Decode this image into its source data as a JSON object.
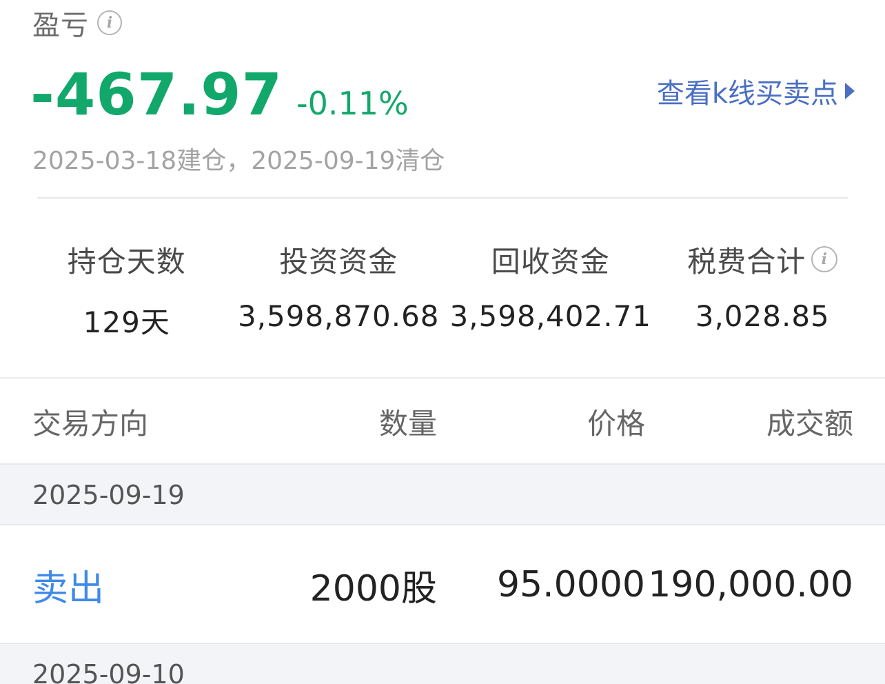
{
  "summary": {
    "title": "盈亏",
    "amount": "-467.97",
    "percent": "-0.11%",
    "kline_link": "查看k线买卖点",
    "date_range": "2025-03-18建仓，2025-09-19清仓",
    "info_glyph": "i"
  },
  "stats": [
    {
      "label": "持仓天数",
      "value": "129天"
    },
    {
      "label": "投资资金",
      "value": "3,598,870.68"
    },
    {
      "label": "回收资金",
      "value": "3,598,402.71"
    },
    {
      "label": "税费合计",
      "value": "3,028.85"
    }
  ],
  "table": {
    "headers": {
      "direction": "交易方向",
      "quantity": "数量",
      "price": "价格",
      "amount": "成交额"
    },
    "groups": [
      {
        "date": "2025-09-19",
        "trades": [
          {
            "direction": "卖出",
            "quantity": "2000股",
            "price": "95.0000",
            "amount": "190,000.00"
          }
        ]
      },
      {
        "date": "2025-09-10",
        "trades": []
      }
    ]
  },
  "colors": {
    "loss_green": "#12a86b",
    "link_blue": "#4a6fc4",
    "sell_blue": "#3f8ae8",
    "band_gray": "#f3f4f7"
  },
  "icons": {
    "info": "info-icon",
    "arrow": "triangle-right-icon"
  }
}
